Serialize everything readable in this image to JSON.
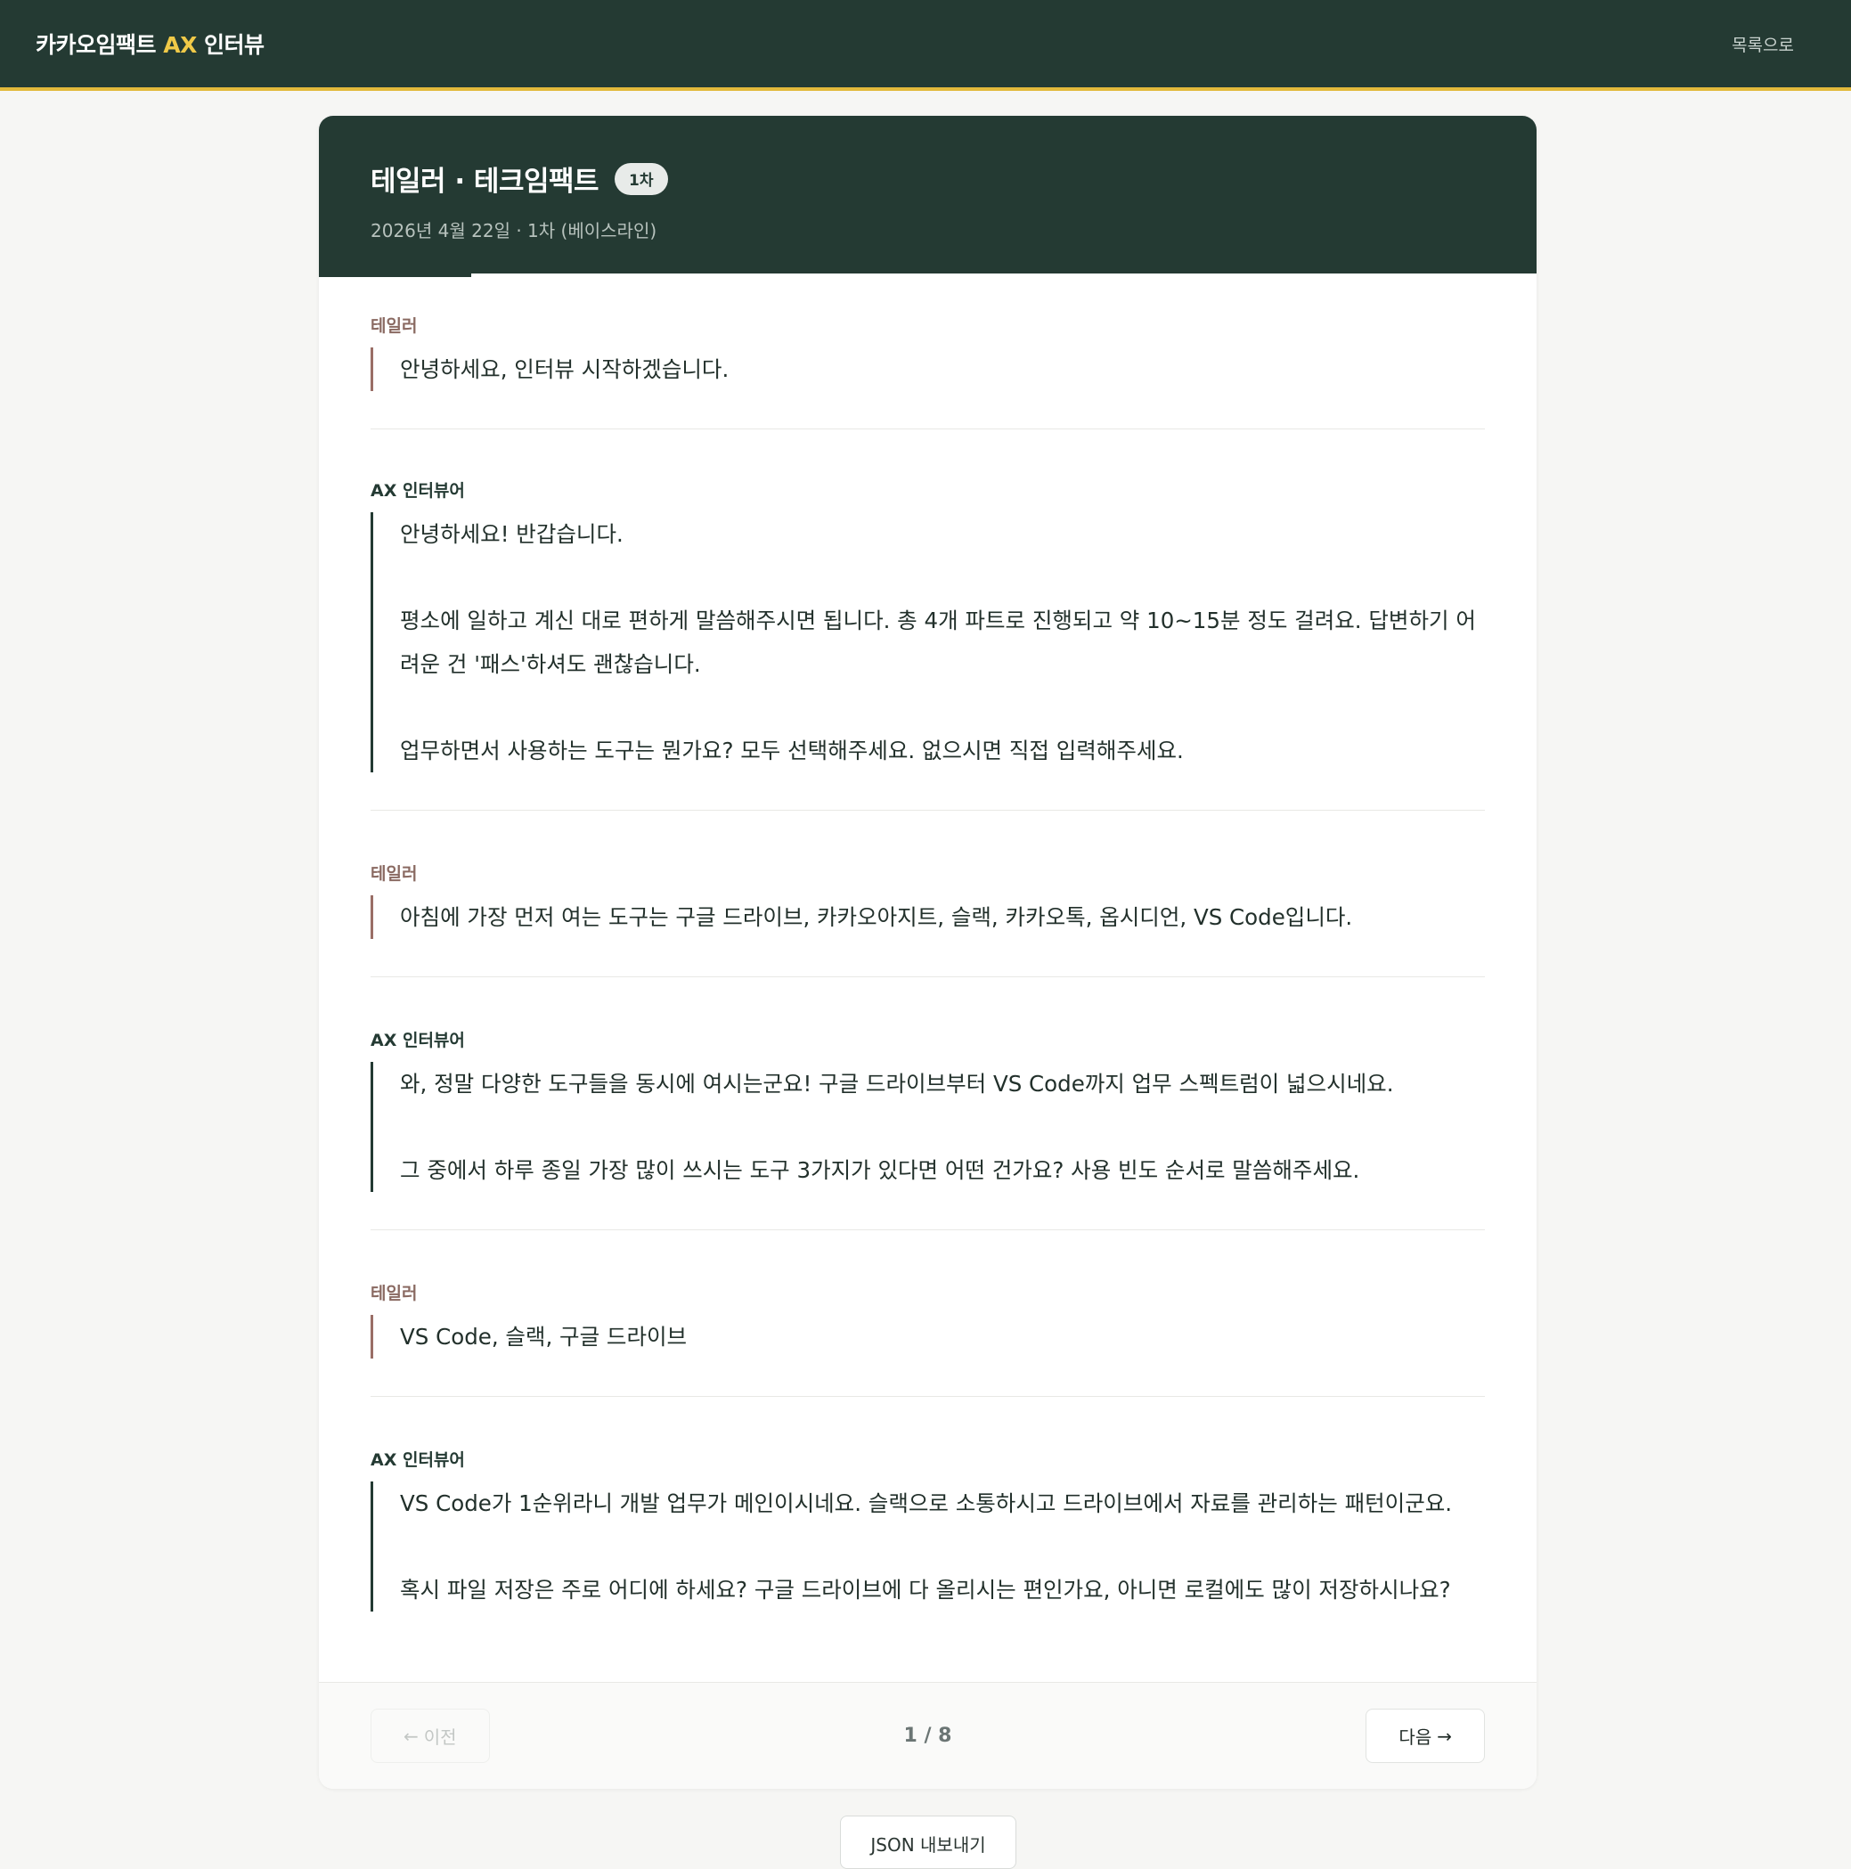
{
  "header": {
    "brand_main": "카카오임팩트 ",
    "brand_accent": "AX",
    "brand_suffix": " 인터뷰",
    "back_label": "목록으로"
  },
  "interview": {
    "title": "테일러 · 테크임팩트",
    "round_badge": "1차",
    "subtitle": "2026년 4월 22일 · 1차 (베이스라인)",
    "progress": 0.125
  },
  "turns": [
    {
      "speaker": "테일러",
      "role": "user",
      "paragraphs": [
        "안녕하세요, 인터뷰 시작하겠습니다."
      ]
    },
    {
      "speaker": "AX 인터뷰어",
      "role": "ai",
      "paragraphs": [
        "안녕하세요! 반갑습니다.",
        "평소에 일하고 계신 대로 편하게 말씀해주시면 됩니다. 총 4개 파트로 진행되고 약 10~15분 정도 걸려요. 답변하기 어려운 건 '패스'하셔도 괜찮습니다.",
        "업무하면서 사용하는 도구는 뭔가요? 모두 선택해주세요. 없으시면 직접 입력해주세요."
      ]
    },
    {
      "speaker": "테일러",
      "role": "user",
      "paragraphs": [
        "아침에 가장 먼저 여는 도구는 구글 드라이브, 카카오아지트, 슬랙, 카카오톡, 옵시디언, VS Code입니다."
      ]
    },
    {
      "speaker": "AX 인터뷰어",
      "role": "ai",
      "paragraphs": [
        "와, 정말 다양한 도구들을 동시에 여시는군요! 구글 드라이브부터 VS Code까지 업무 스펙트럼이 넓으시네요.",
        "그 중에서 하루 종일 가장 많이 쓰시는 도구 3가지가 있다면 어떤 건가요? 사용 빈도 순서로 말씀해주세요."
      ]
    },
    {
      "speaker": "테일러",
      "role": "user",
      "paragraphs": [
        "VS Code, 슬랙, 구글 드라이브"
      ]
    },
    {
      "speaker": "AX 인터뷰어",
      "role": "ai",
      "paragraphs": [
        "VS Code가 1순위라니 개발 업무가 메인이시네요. 슬랙으로 소통하시고 드라이브에서 자료를 관리하는 패턴이군요.",
        "혹시 파일 저장은 주로 어디에 하세요? 구글 드라이브에 다 올리시는 편인가요, 아니면 로컬에도 많이 저장하시나요?"
      ]
    }
  ],
  "footer": {
    "prev_label": "이전",
    "next_label": "다음",
    "pager": "1 / 8"
  },
  "export_label": "JSON 내보내기"
}
